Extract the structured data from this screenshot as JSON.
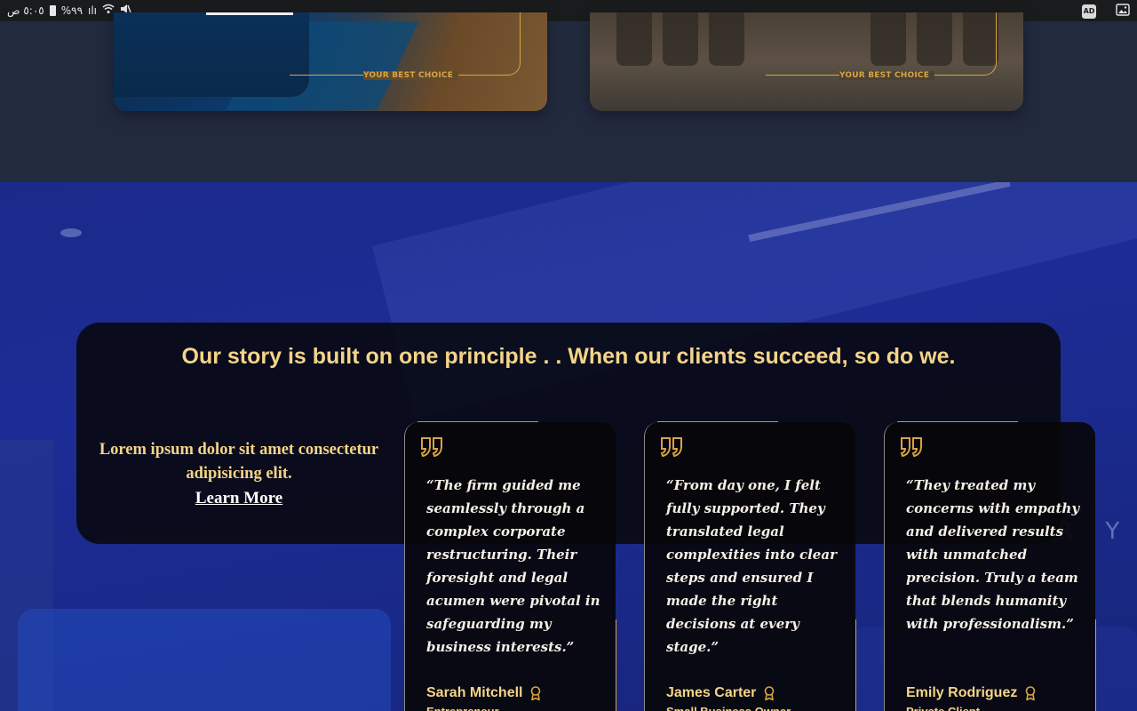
{
  "status_bar": {
    "time": "٥:٠٥ ص",
    "battery": "%٩٩",
    "icons": [
      "battery-icon",
      "signal-icon",
      "wifi-icon",
      "mute-icon",
      "ad-block-icon",
      "gallery-icon"
    ]
  },
  "cards": [
    {
      "tag": "YOUR BEST CHOICE"
    },
    {
      "tag": "YOUR BEST CHOICE"
    }
  ],
  "story": {
    "heading": "Our story is built on one principle . . When our clients succeed, so do we.",
    "blurb": "Lorem ipsum dolor sit amet consectetur adipisicing elit.",
    "link": "Learn More"
  },
  "testimonials": [
    {
      "quote": "“The firm guided me seamlessly through a complex corporate restructuring. Their foresight and legal acumen were pivotal in safeguarding my business interests.”",
      "name": "Sarah Mitchell",
      "role": "Entrepreneur"
    },
    {
      "quote": "“From day one, I felt fully supported. They translated legal complexities into clear steps and ensured I made the right decisions at every stage.”",
      "name": "James Carter",
      "role": "Small Business Owner"
    },
    {
      "quote": "“They treated my concerns with empathy and delivered results with unmatched precision. Truly a team that blends humanity with professionalism.”",
      "name": "Emily Rodriguez",
      "role": "Private Client"
    }
  ],
  "colors": {
    "accent": "#f4d488",
    "gold_line": "#d9a441",
    "hero_blue": "#1c2c96",
    "panel": "#08080c"
  }
}
